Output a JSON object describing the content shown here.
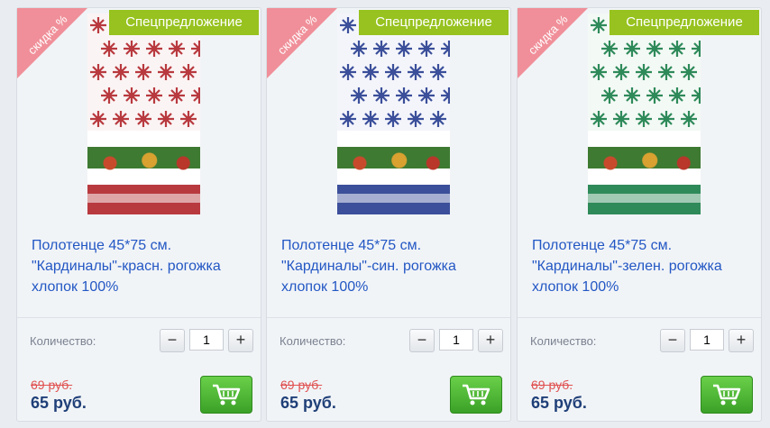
{
  "products": [
    {
      "promo_label": "Спецпредложение",
      "discount_label": "скидка %",
      "title": "Полотенце 45*75 см. \"Кардиналы\"-красн. рогожка хлопок 100%",
      "quantity_label": "Количество:",
      "quantity_value": "1",
      "old_price": "69 руб.",
      "price": "65 руб.",
      "pattern_color": "#b83a3f"
    },
    {
      "promo_label": "Спецпредложение",
      "discount_label": "скидка %",
      "title": "Полотенце 45*75 см. \"Кардиналы\"-син. рогожка хлопок 100%",
      "quantity_label": "Количество:",
      "quantity_value": "1",
      "old_price": "69 руб.",
      "price": "65 руб.",
      "pattern_color": "#3b4f9a"
    },
    {
      "promo_label": "Спецпредложение",
      "discount_label": "скидка %",
      "title": "Полотенце 45*75 см. \"Кардиналы\"-зелен. рогожка хлопок 100%",
      "quantity_label": "Количество:",
      "quantity_value": "1",
      "old_price": "69 руб.",
      "price": "65 руб.",
      "pattern_color": "#2f8a5a"
    }
  ],
  "icons": {
    "minus": "minus-icon",
    "plus": "plus-icon",
    "cart": "shopping-cart-icon"
  },
  "colors": {
    "promo": "#97c21f",
    "discount": "#f07c88",
    "title": "#2357c4",
    "old_price": "#e05050",
    "price": "#1f3f78",
    "cart": "#3aa127"
  }
}
